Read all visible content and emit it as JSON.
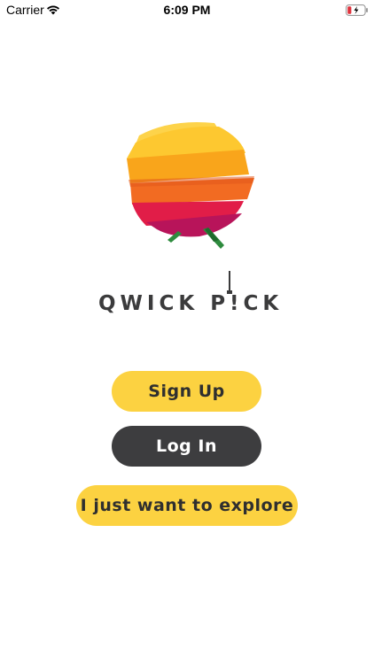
{
  "status_bar": {
    "carrier": "Carrier",
    "time": "6:09 PM",
    "icons": [
      "wifi-icon",
      "battery-icon"
    ],
    "battery_color": "#e0323c"
  },
  "logo": {
    "wordmark": "QWICK P!CK",
    "icon": "sliced-fruit-logo",
    "colors": [
      "#fcd241",
      "#f9a51b",
      "#f26b22",
      "#e11d48",
      "#a0125a",
      "#2e8b3e"
    ]
  },
  "buttons": {
    "sign_up": "Sign Up",
    "log_in": "Log In",
    "explore": "I just want to explore"
  },
  "theme": {
    "accent": "#fcd241",
    "dark": "#3d3d3f"
  }
}
